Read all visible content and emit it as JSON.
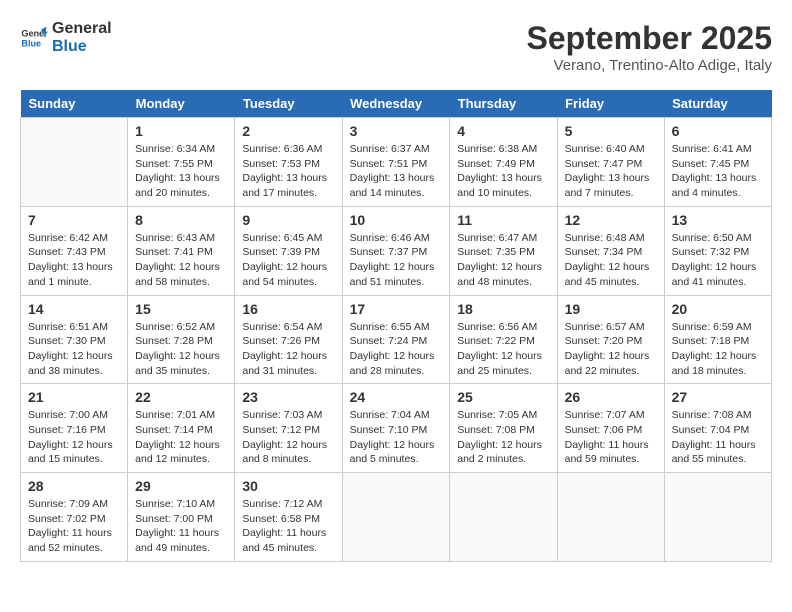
{
  "logo": {
    "line1": "General",
    "line2": "Blue"
  },
  "title": "September 2025",
  "subtitle": "Verano, Trentino-Alto Adige, Italy",
  "headers": [
    "Sunday",
    "Monday",
    "Tuesday",
    "Wednesday",
    "Thursday",
    "Friday",
    "Saturday"
  ],
  "weeks": [
    [
      {
        "num": "",
        "info": ""
      },
      {
        "num": "1",
        "info": "Sunrise: 6:34 AM\nSunset: 7:55 PM\nDaylight: 13 hours\nand 20 minutes."
      },
      {
        "num": "2",
        "info": "Sunrise: 6:36 AM\nSunset: 7:53 PM\nDaylight: 13 hours\nand 17 minutes."
      },
      {
        "num": "3",
        "info": "Sunrise: 6:37 AM\nSunset: 7:51 PM\nDaylight: 13 hours\nand 14 minutes."
      },
      {
        "num": "4",
        "info": "Sunrise: 6:38 AM\nSunset: 7:49 PM\nDaylight: 13 hours\nand 10 minutes."
      },
      {
        "num": "5",
        "info": "Sunrise: 6:40 AM\nSunset: 7:47 PM\nDaylight: 13 hours\nand 7 minutes."
      },
      {
        "num": "6",
        "info": "Sunrise: 6:41 AM\nSunset: 7:45 PM\nDaylight: 13 hours\nand 4 minutes."
      }
    ],
    [
      {
        "num": "7",
        "info": "Sunrise: 6:42 AM\nSunset: 7:43 PM\nDaylight: 13 hours\nand 1 minute."
      },
      {
        "num": "8",
        "info": "Sunrise: 6:43 AM\nSunset: 7:41 PM\nDaylight: 12 hours\nand 58 minutes."
      },
      {
        "num": "9",
        "info": "Sunrise: 6:45 AM\nSunset: 7:39 PM\nDaylight: 12 hours\nand 54 minutes."
      },
      {
        "num": "10",
        "info": "Sunrise: 6:46 AM\nSunset: 7:37 PM\nDaylight: 12 hours\nand 51 minutes."
      },
      {
        "num": "11",
        "info": "Sunrise: 6:47 AM\nSunset: 7:35 PM\nDaylight: 12 hours\nand 48 minutes."
      },
      {
        "num": "12",
        "info": "Sunrise: 6:48 AM\nSunset: 7:34 PM\nDaylight: 12 hours\nand 45 minutes."
      },
      {
        "num": "13",
        "info": "Sunrise: 6:50 AM\nSunset: 7:32 PM\nDaylight: 12 hours\nand 41 minutes."
      }
    ],
    [
      {
        "num": "14",
        "info": "Sunrise: 6:51 AM\nSunset: 7:30 PM\nDaylight: 12 hours\nand 38 minutes."
      },
      {
        "num": "15",
        "info": "Sunrise: 6:52 AM\nSunset: 7:28 PM\nDaylight: 12 hours\nand 35 minutes."
      },
      {
        "num": "16",
        "info": "Sunrise: 6:54 AM\nSunset: 7:26 PM\nDaylight: 12 hours\nand 31 minutes."
      },
      {
        "num": "17",
        "info": "Sunrise: 6:55 AM\nSunset: 7:24 PM\nDaylight: 12 hours\nand 28 minutes."
      },
      {
        "num": "18",
        "info": "Sunrise: 6:56 AM\nSunset: 7:22 PM\nDaylight: 12 hours\nand 25 minutes."
      },
      {
        "num": "19",
        "info": "Sunrise: 6:57 AM\nSunset: 7:20 PM\nDaylight: 12 hours\nand 22 minutes."
      },
      {
        "num": "20",
        "info": "Sunrise: 6:59 AM\nSunset: 7:18 PM\nDaylight: 12 hours\nand 18 minutes."
      }
    ],
    [
      {
        "num": "21",
        "info": "Sunrise: 7:00 AM\nSunset: 7:16 PM\nDaylight: 12 hours\nand 15 minutes."
      },
      {
        "num": "22",
        "info": "Sunrise: 7:01 AM\nSunset: 7:14 PM\nDaylight: 12 hours\nand 12 minutes."
      },
      {
        "num": "23",
        "info": "Sunrise: 7:03 AM\nSunset: 7:12 PM\nDaylight: 12 hours\nand 8 minutes."
      },
      {
        "num": "24",
        "info": "Sunrise: 7:04 AM\nSunset: 7:10 PM\nDaylight: 12 hours\nand 5 minutes."
      },
      {
        "num": "25",
        "info": "Sunrise: 7:05 AM\nSunset: 7:08 PM\nDaylight: 12 hours\nand 2 minutes."
      },
      {
        "num": "26",
        "info": "Sunrise: 7:07 AM\nSunset: 7:06 PM\nDaylight: 11 hours\nand 59 minutes."
      },
      {
        "num": "27",
        "info": "Sunrise: 7:08 AM\nSunset: 7:04 PM\nDaylight: 11 hours\nand 55 minutes."
      }
    ],
    [
      {
        "num": "28",
        "info": "Sunrise: 7:09 AM\nSunset: 7:02 PM\nDaylight: 11 hours\nand 52 minutes."
      },
      {
        "num": "29",
        "info": "Sunrise: 7:10 AM\nSunset: 7:00 PM\nDaylight: 11 hours\nand 49 minutes."
      },
      {
        "num": "30",
        "info": "Sunrise: 7:12 AM\nSunset: 6:58 PM\nDaylight: 11 hours\nand 45 minutes."
      },
      {
        "num": "",
        "info": ""
      },
      {
        "num": "",
        "info": ""
      },
      {
        "num": "",
        "info": ""
      },
      {
        "num": "",
        "info": ""
      }
    ]
  ]
}
